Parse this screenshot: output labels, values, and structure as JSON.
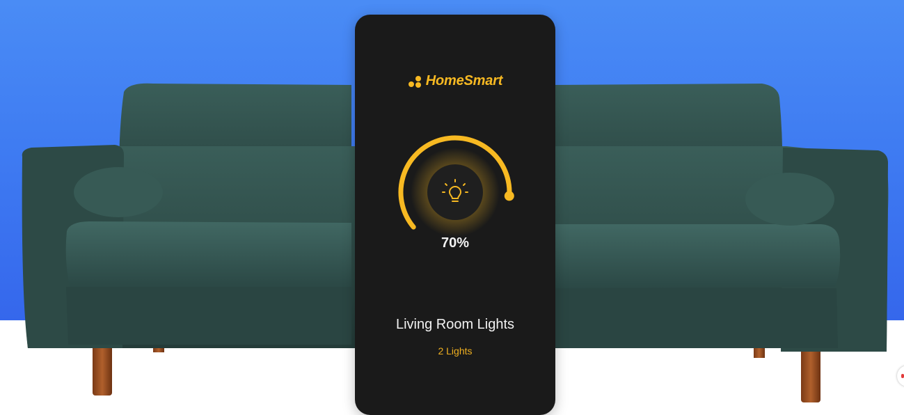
{
  "app": {
    "brand_name": "HomeSmart"
  },
  "dimmer": {
    "level_percent": 70,
    "level_label": "70%"
  },
  "room": {
    "name": "Living Room Lights",
    "lights_count_label": "2 Lights"
  },
  "colors": {
    "background_blue": "#3f7cf2",
    "card": "#1a1a1a",
    "accent": "#f7b922",
    "sofa": "#2f4f4b"
  },
  "icons": {
    "brand": "dots-logo-icon",
    "dimmer": "lightbulb-icon"
  }
}
